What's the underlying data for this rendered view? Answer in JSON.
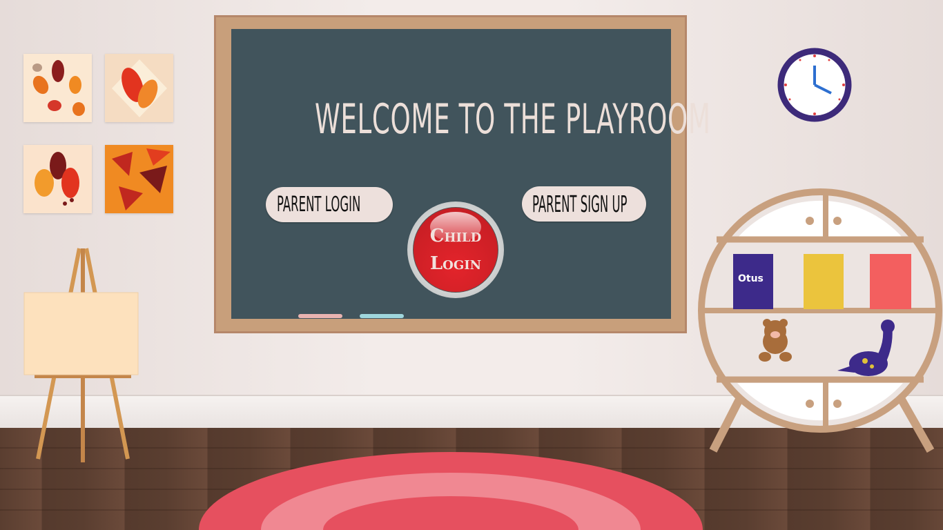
{
  "title": "WELCOME TO THE PLAYROOM",
  "buttons": {
    "parent_login": "PARENT LOGIN",
    "parent_signup": "PARENT SIGN UP",
    "child_line1": "Child",
    "child_line2": "Login"
  },
  "shelf": {
    "book_label": "Otus"
  },
  "colors": {
    "board": "#41545c",
    "frame": "#c89f7b",
    "pill": "#ede0dc",
    "child_red": "#d42027",
    "clock_border": "#3d2a7a",
    "rug": "#e6505f"
  }
}
